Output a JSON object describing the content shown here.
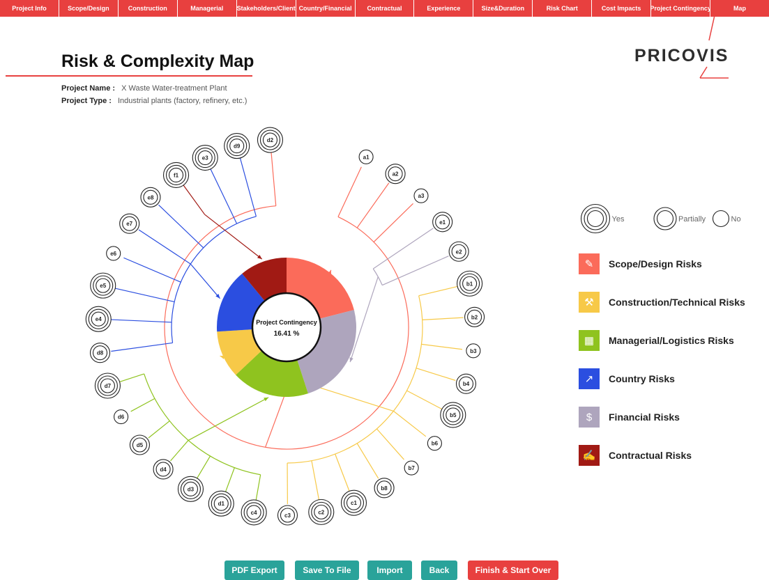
{
  "nav": {
    "tabs": [
      "Project Info",
      "Scope/Design",
      "Construction",
      "Managerial",
      "Stakeholders/Client",
      "Country/Financial",
      "Contractual",
      "Experience",
      "Size&Duration",
      "Risk Chart",
      "Cost Impacts",
      "Project Contingency",
      "Map"
    ]
  },
  "page": {
    "title": "Risk & Complexity Map",
    "brand": "PRICOVIS",
    "project_name_label": "Project Name :",
    "project_name": "X Waste Water-treatment Plant",
    "project_type_label": "Project Type :",
    "project_type": "Industrial plants (factory, refinery, etc.)"
  },
  "center": {
    "label": "Project Contingency",
    "value": "16.41 %"
  },
  "colors": {
    "scope": "#fb6b5a",
    "construction": "#f7c948",
    "managerial": "#8fc31f",
    "country": "#2b4ee0",
    "financial": "#aea5bd",
    "contractual": "#a11a14",
    "accent": "#e8403f",
    "teal": "#2aa39a"
  },
  "pie": [
    {
      "category": "Scope/Design",
      "color": "#fb6b5a",
      "fraction": 0.21
    },
    {
      "category": "Financial",
      "color": "#aea5bd",
      "fraction": 0.24
    },
    {
      "category": "Managerial",
      "color": "#8fc31f",
      "fraction": 0.18
    },
    {
      "category": "Construction",
      "color": "#f7c948",
      "fraction": 0.11
    },
    {
      "category": "Country",
      "color": "#2b4ee0",
      "fraction": 0.15
    },
    {
      "category": "Contractual",
      "color": "#a11a14",
      "fraction": 0.11
    }
  ],
  "nodes": [
    {
      "id": "a1",
      "level": "No",
      "category": "scope"
    },
    {
      "id": "a2",
      "level": "Partially",
      "category": "scope"
    },
    {
      "id": "a3",
      "level": "No",
      "category": "scope"
    },
    {
      "id": "e1",
      "level": "Partially",
      "category": "financial"
    },
    {
      "id": "e2",
      "level": "Partially",
      "category": "financial"
    },
    {
      "id": "b1",
      "level": "Yes",
      "category": "construction"
    },
    {
      "id": "b2",
      "level": "Partially",
      "category": "construction"
    },
    {
      "id": "b3",
      "level": "No",
      "category": "construction"
    },
    {
      "id": "b4",
      "level": "Partially",
      "category": "construction"
    },
    {
      "id": "b5",
      "level": "Yes",
      "category": "construction"
    },
    {
      "id": "b6",
      "level": "No",
      "category": "construction"
    },
    {
      "id": "b7",
      "level": "No",
      "category": "construction"
    },
    {
      "id": "b8",
      "level": "Partially",
      "category": "construction"
    },
    {
      "id": "c1",
      "level": "Yes",
      "category": "construction"
    },
    {
      "id": "c2",
      "level": "Yes",
      "category": "construction"
    },
    {
      "id": "c3",
      "level": "Partially",
      "category": "construction"
    },
    {
      "id": "c4",
      "level": "Yes",
      "category": "managerial"
    },
    {
      "id": "d1",
      "level": "Yes",
      "category": "managerial"
    },
    {
      "id": "d3",
      "level": "Yes",
      "category": "managerial"
    },
    {
      "id": "d4",
      "level": "Partially",
      "category": "managerial"
    },
    {
      "id": "d5",
      "level": "Partially",
      "category": "managerial"
    },
    {
      "id": "d6",
      "level": "No",
      "category": "managerial"
    },
    {
      "id": "d7",
      "level": "Yes",
      "category": "managerial"
    },
    {
      "id": "d8",
      "level": "Partially",
      "category": "country"
    },
    {
      "id": "e4",
      "level": "Yes",
      "category": "country"
    },
    {
      "id": "e5",
      "level": "Yes",
      "category": "country"
    },
    {
      "id": "e6",
      "level": "No",
      "category": "country"
    },
    {
      "id": "e7",
      "level": "Partially",
      "category": "country"
    },
    {
      "id": "e8",
      "level": "Partially",
      "category": "country"
    },
    {
      "id": "f1",
      "level": "Yes",
      "category": "contractual"
    },
    {
      "id": "e3",
      "level": "Yes",
      "category": "country"
    },
    {
      "id": "d9",
      "level": "Yes",
      "category": "country"
    },
    {
      "id": "d2",
      "level": "Yes",
      "category": "scope"
    }
  ],
  "legend": {
    "rings": [
      {
        "label": "Yes",
        "rings": 3
      },
      {
        "label": "Partially",
        "rings": 2
      },
      {
        "label": "No",
        "rings": 1
      }
    ],
    "categories": [
      {
        "label": "Scope/Design Risks",
        "color": "#fb6b5a",
        "icon": "pencil-ruler-icon",
        "glyph": "✎"
      },
      {
        "label": "Construction/Technical Risks",
        "color": "#f7c948",
        "icon": "crane-icon",
        "glyph": "⚒"
      },
      {
        "label": "Managerial/Logistics Risks",
        "color": "#8fc31f",
        "icon": "map-icon",
        "glyph": "▦"
      },
      {
        "label": "Country Risks",
        "color": "#2b4ee0",
        "icon": "trend-chart-icon",
        "glyph": "↗"
      },
      {
        "label": "Financial Risks",
        "color": "#aea5bd",
        "icon": "money-hand-icon",
        "glyph": "$"
      },
      {
        "label": "Contractual Risks",
        "color": "#a11a14",
        "icon": "contract-document-icon",
        "glyph": "✍"
      }
    ]
  },
  "buttons": {
    "pdf_export": "PDF Export",
    "save_to_file": "Save To File",
    "import": "Import",
    "back": "Back",
    "finish": "Finish & Start Over"
  }
}
